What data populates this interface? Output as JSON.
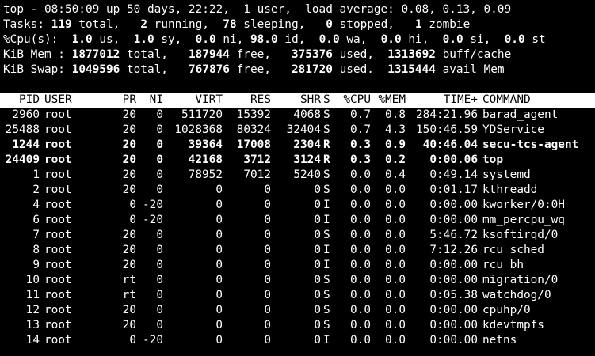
{
  "summary": {
    "uptime_line": "top - 08:50:09 up 50 days, 22:22,  1 user,  load average: 0.08, 0.13, 0.09",
    "tasks": {
      "label": "Tasks:",
      "total": "119",
      "total_label": "total,",
      "running": "2",
      "running_label": "running,",
      "sleeping": "78",
      "sleeping_label": "sleeping,",
      "stopped": "0",
      "stopped_label": "stopped,",
      "zombie": "1",
      "zombie_label": "zombie"
    },
    "cpu": {
      "label": "%Cpu(s):",
      "us": "1.0",
      "us_label": "us,",
      "sy": "1.0",
      "sy_label": "sy,",
      "ni": "0.0",
      "ni_label": "ni,",
      "id": "98.0",
      "id_label": "id,",
      "wa": "0.0",
      "wa_label": "wa,",
      "hi": "0.0",
      "hi_label": "hi,",
      "si": "0.0",
      "si_label": "si,",
      "st": "0.0",
      "st_label": "st"
    },
    "mem": {
      "label": "KiB Mem :",
      "total": "1877012",
      "total_label": "total,",
      "free": "187944",
      "free_label": "free,",
      "used": "375376",
      "used_label": "used,",
      "buff_cache": "1313692",
      "buff_cache_label": "buff/cache"
    },
    "swap": {
      "label": "KiB Swap:",
      "total": "1049596",
      "total_label": "total,",
      "free": "767876",
      "free_label": "free,",
      "used": "281720",
      "used_label": "used.",
      "avail": "1315444",
      "avail_label": "avail Mem"
    }
  },
  "columns": {
    "pid": "PID",
    "user": "USER",
    "pr": "PR",
    "ni": "NI",
    "virt": "VIRT",
    "res": "RES",
    "shr": "SHR",
    "s": "S",
    "cpu": "%CPU",
    "mem": "%MEM",
    "time": "TIME+",
    "command": "COMMAND"
  },
  "processes": [
    {
      "pid": "2960",
      "user": "root",
      "pr": "20",
      "ni": "0",
      "virt": "511720",
      "res": "15392",
      "shr": "4068",
      "s": "S",
      "cpu": "0.7",
      "mem": "0.8",
      "time": "284:21.96",
      "command": "barad_agent",
      "bold": false
    },
    {
      "pid": "25488",
      "user": "root",
      "pr": "20",
      "ni": "0",
      "virt": "1028368",
      "res": "80324",
      "shr": "32404",
      "s": "S",
      "cpu": "0.7",
      "mem": "4.3",
      "time": "150:46.59",
      "command": "YDService",
      "bold": false
    },
    {
      "pid": "1244",
      "user": "root",
      "pr": "20",
      "ni": "0",
      "virt": "39364",
      "res": "17008",
      "shr": "2304",
      "s": "R",
      "cpu": "0.3",
      "mem": "0.9",
      "time": "40:46.04",
      "command": "secu-tcs-agent",
      "bold": true
    },
    {
      "pid": "24409",
      "user": "root",
      "pr": "20",
      "ni": "0",
      "virt": "42168",
      "res": "3712",
      "shr": "3124",
      "s": "R",
      "cpu": "0.3",
      "mem": "0.2",
      "time": "0:00.06",
      "command": "top",
      "bold": true
    },
    {
      "pid": "1",
      "user": "root",
      "pr": "20",
      "ni": "0",
      "virt": "78952",
      "res": "7012",
      "shr": "5240",
      "s": "S",
      "cpu": "0.0",
      "mem": "0.4",
      "time": "0:49.14",
      "command": "systemd",
      "bold": false
    },
    {
      "pid": "2",
      "user": "root",
      "pr": "20",
      "ni": "0",
      "virt": "0",
      "res": "0",
      "shr": "0",
      "s": "S",
      "cpu": "0.0",
      "mem": "0.0",
      "time": "0:01.17",
      "command": "kthreadd",
      "bold": false
    },
    {
      "pid": "4",
      "user": "root",
      "pr": "0",
      "ni": "-20",
      "virt": "0",
      "res": "0",
      "shr": "0",
      "s": "I",
      "cpu": "0.0",
      "mem": "0.0",
      "time": "0:00.00",
      "command": "kworker/0:0H",
      "bold": false
    },
    {
      "pid": "6",
      "user": "root",
      "pr": "0",
      "ni": "-20",
      "virt": "0",
      "res": "0",
      "shr": "0",
      "s": "I",
      "cpu": "0.0",
      "mem": "0.0",
      "time": "0:00.00",
      "command": "mm_percpu_wq",
      "bold": false
    },
    {
      "pid": "7",
      "user": "root",
      "pr": "20",
      "ni": "0",
      "virt": "0",
      "res": "0",
      "shr": "0",
      "s": "S",
      "cpu": "0.0",
      "mem": "0.0",
      "time": "5:46.72",
      "command": "ksoftirqd/0",
      "bold": false
    },
    {
      "pid": "8",
      "user": "root",
      "pr": "20",
      "ni": "0",
      "virt": "0",
      "res": "0",
      "shr": "0",
      "s": "I",
      "cpu": "0.0",
      "mem": "0.0",
      "time": "7:12.26",
      "command": "rcu_sched",
      "bold": false
    },
    {
      "pid": "9",
      "user": "root",
      "pr": "20",
      "ni": "0",
      "virt": "0",
      "res": "0",
      "shr": "0",
      "s": "I",
      "cpu": "0.0",
      "mem": "0.0",
      "time": "0:00.00",
      "command": "rcu_bh",
      "bold": false
    },
    {
      "pid": "10",
      "user": "root",
      "pr": "rt",
      "ni": "0",
      "virt": "0",
      "res": "0",
      "shr": "0",
      "s": "S",
      "cpu": "0.0",
      "mem": "0.0",
      "time": "0:00.00",
      "command": "migration/0",
      "bold": false
    },
    {
      "pid": "11",
      "user": "root",
      "pr": "rt",
      "ni": "0",
      "virt": "0",
      "res": "0",
      "shr": "0",
      "s": "S",
      "cpu": "0.0",
      "mem": "0.0",
      "time": "0:05.38",
      "command": "watchdog/0",
      "bold": false
    },
    {
      "pid": "12",
      "user": "root",
      "pr": "20",
      "ni": "0",
      "virt": "0",
      "res": "0",
      "shr": "0",
      "s": "S",
      "cpu": "0.0",
      "mem": "0.0",
      "time": "0:00.00",
      "command": "cpuhp/0",
      "bold": false
    },
    {
      "pid": "13",
      "user": "root",
      "pr": "20",
      "ni": "0",
      "virt": "0",
      "res": "0",
      "shr": "0",
      "s": "S",
      "cpu": "0.0",
      "mem": "0.0",
      "time": "0:00.00",
      "command": "kdevtmpfs",
      "bold": false
    },
    {
      "pid": "14",
      "user": "root",
      "pr": "0",
      "ni": "-20",
      "virt": "0",
      "res": "0",
      "shr": "0",
      "s": "I",
      "cpu": "0.0",
      "mem": "0.0",
      "time": "0:00.00",
      "command": "netns",
      "bold": false
    }
  ]
}
